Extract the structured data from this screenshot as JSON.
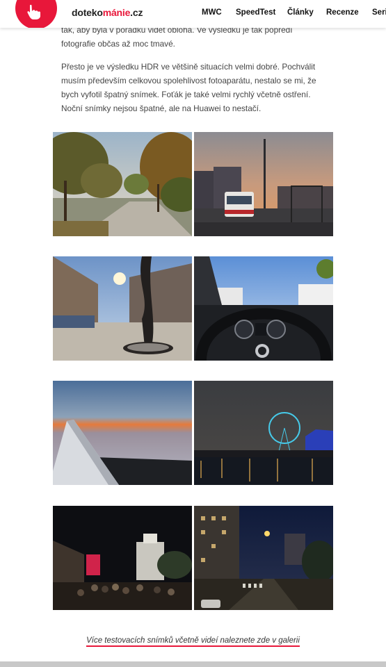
{
  "header": {
    "brand_part1": "doteko",
    "brand_part2": "mánie",
    "brand_part3": ".cz",
    "nav": [
      "MWC",
      "SpeedTest",
      "Články",
      "Recenze",
      "Seriá"
    ]
  },
  "article": {
    "paragraph1": "tak, aby byla v pořádku vidět obloha. Ve výsledku je tak popředí fotografie občas až moc tmavé.",
    "paragraph2": "Přesto je ve výsledku HDR ve většině situacích velmi dobré. Pochválit musím především celkovou spolehlivost fotoaparátu, nestalo se mi, že bych vyfotil špatný snímek. Foťák je také velmi rychlý včetně ostření. Noční snímky nejsou špatné, ale na Huawei to nestačí."
  },
  "gallery": {
    "photos": [
      "park-autumn-photo",
      "city-sunset-bus-photo",
      "square-sculpture-photo",
      "car-dashboard-photo",
      "airplane-wing-sunset-photo",
      "london-eye-night-photo",
      "night-crowd-street-photo",
      "night-city-street-photo"
    ],
    "link_text": "Více testovacích snímků včetně videí naleznete zde v galerii"
  },
  "colors": {
    "accent": "#e8173a"
  }
}
